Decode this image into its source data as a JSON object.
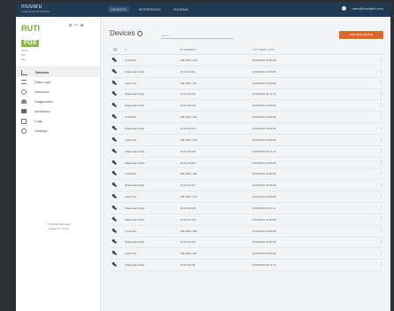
{
  "topbar": {
    "brand": "muvaru",
    "brand_sub": "A SIEMENS BUSINESS",
    "nav": [
      "DEVICES",
      "INTERFACES",
      "SCHEMA"
    ],
    "user": "user@example.com"
  },
  "sidebar": {
    "logo_top": "RUTI",
    "logo_bottom": "FOX",
    "badge": "5%",
    "meta": [
      "name",
      "GS",
      "info"
    ],
    "menu": [
      "Devices",
      "Data Logs",
      "Networks",
      "Diagnostics",
      "Interfaces",
      "Logs",
      "Settings"
    ],
    "footer": "© Software Manager\nVersion 1.7.12.11"
  },
  "main": {
    "title": "Devices",
    "search_placeholder": "search",
    "add_button": "ADD NEW DEVICE",
    "columns": [
      "#",
      "IP ADDRESS",
      "LAST SEEN (UTC)"
    ],
    "rows": [
      {
        "name": "Controller",
        "ip": "192.168.1.100",
        "seen": "11/14/2016 11:08:40"
      },
      {
        "name": "Diagnostic Node",
        "ip": "10.10.10.121",
        "seen": "11/14/2016 11:08:40"
      },
      {
        "name": "Light Unit",
        "ip": "192.168.1.101",
        "seen": "11/14/2016 11:08:40"
      },
      {
        "name": "Diagnostic Node",
        "ip": "10.10.10.122",
        "seen": "11/14/2016 11:11:11"
      },
      {
        "name": "Diagnostic Node",
        "ip": "10.10.10.123",
        "seen": "11/14/2016 11:08:40"
      },
      {
        "name": "Controller",
        "ip": "192.168.1.102",
        "seen": "11/14/2016 11:08:40"
      },
      {
        "name": "Diagnostic Node",
        "ip": "10.10.10.124",
        "seen": "11/14/2016 11:08:40"
      },
      {
        "name": "Light Unit",
        "ip": "192.168.1.103",
        "seen": "11/14/2016 11:08:40"
      },
      {
        "name": "Diagnostic Node",
        "ip": "10.10.10.125",
        "seen": "11/14/2016 11:11:11"
      },
      {
        "name": "Diagnostic Node",
        "ip": "10.10.10.126",
        "seen": "11/14/2016 11:08:40"
      },
      {
        "name": "Controller",
        "ip": "192.168.1.104",
        "seen": "11/14/2016 11:08:40"
      },
      {
        "name": "Diagnostic Node",
        "ip": "10.10.10.127",
        "seen": "11/14/2016 11:08:40"
      },
      {
        "name": "Light Unit",
        "ip": "192.168.1.105",
        "seen": "11/14/2016 11:08:40"
      },
      {
        "name": "Diagnostic Node",
        "ip": "10.10.10.128",
        "seen": "11/14/2016 11:11:11"
      },
      {
        "name": "Diagnostic Node",
        "ip": "10.10.10.129",
        "seen": "11/14/2016 11:08:40"
      },
      {
        "name": "Controller",
        "ip": "192.168.1.106",
        "seen": "11/14/2016 11:08:40"
      },
      {
        "name": "Diagnostic Node",
        "ip": "10.10.10.130",
        "seen": "11/14/2016 11:08:40"
      },
      {
        "name": "Light Unit",
        "ip": "192.168.1.107",
        "seen": "11/14/2016 11:08:40"
      },
      {
        "name": "Diagnostic Node",
        "ip": "10.10.10.131",
        "seen": "11/14/2016 11:11:11"
      }
    ]
  },
  "colors": {
    "accent": "#e5632a",
    "topbar": "#1f3a52",
    "logo": "#8cb84a"
  }
}
